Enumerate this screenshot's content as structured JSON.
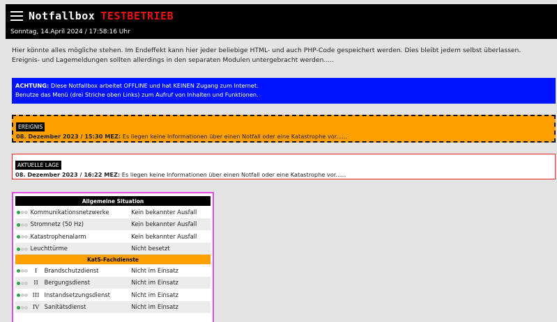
{
  "header": {
    "title": "Notfallbox",
    "title_suffix": "TESTBETRIEB",
    "datetime": "Sonntag, 14.April 2024 / 17:58:16 Uhr",
    "menu_icon": "hamburger-icon"
  },
  "intro": {
    "line1": "Hier könnte alles mögliche stehen. Im Endeffekt kann hier jeder beliebige HTML- und auch PHP-Code gespeichert werden. Dies bleibt jedem selbst überlassen.",
    "line2": "Ereignis- und Lagemeldungen sollten allerdings in den separaten Modulen untergebracht werden....."
  },
  "notice": {
    "label": "ACHTUNG:",
    "line1": " Diese Notfallbox arbeitet OFFLINE und hat KEINEN Zugang zum Internet.",
    "line2": "Benutze das Menü (drei Striche oben Links) zum Aufruf von Inhalten und Funktionen."
  },
  "ereignis": {
    "tag": "EREIGNIS",
    "date": "08. Dezember 2023 / 15:30 MEZ:",
    "text": " Es liegen keine Informationen über einen Notfall oder eine Katastrophe vor......"
  },
  "lage": {
    "tag": "AKTUELLE LAGE",
    "date": "08. Dezember 2023 / 16:22 MEZ:",
    "text": " Es liegen keine Informationen über einen Notfall oder eine Katastrophe vor......"
  },
  "status": {
    "section1_title": "Allgemeine Situation",
    "section1": [
      {
        "label": "Kommunikationsnetzwerke",
        "value": "Kein bekannter Ausfall"
      },
      {
        "label": "Stromnetz (50 Hz)",
        "value": "Kein bekannter Ausfall"
      },
      {
        "label": "Katastrophenalarm",
        "value": "Kein bekannter Ausfall"
      },
      {
        "label": "Leuchttürme",
        "value": "Nicht besetzt"
      }
    ],
    "section2_title": "KatS-Fachdienste",
    "section2": [
      {
        "num": "I",
        "label": "Brandschutzdienst",
        "value": "Nicht im Einsatz"
      },
      {
        "num": "II",
        "label": "Bergungsdienst",
        "value": "Nicht im Einsatz"
      },
      {
        "num": "III",
        "label": "Instandsetzungsdienst",
        "value": "Nicht im Einsatz"
      },
      {
        "num": "IV",
        "label": "Sanitätsdienst",
        "value": "Nicht im Einsatz"
      }
    ]
  },
  "colors": {
    "header_bg": "#000000",
    "testbetrieb": "#ee1111",
    "notice_bg": "#0014ff",
    "ereignis_bg": "#ffa000",
    "lage_border": "#ee2222",
    "panel_border": "#e14be1",
    "indicator_on": "#2ca24a"
  }
}
